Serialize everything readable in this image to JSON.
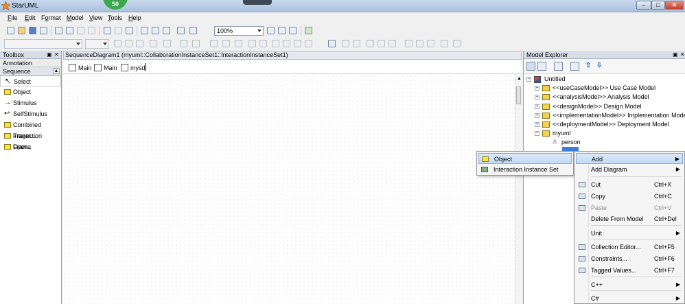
{
  "window": {
    "title": "StarUML",
    "badge": "50"
  },
  "menubar": [
    {
      "pre": "",
      "u": "F",
      "post": "ile"
    },
    {
      "pre": "",
      "u": "E",
      "post": "dit"
    },
    {
      "pre": "F",
      "u": "o",
      "post": "rmat"
    },
    {
      "pre": "",
      "u": "M",
      "post": "odel"
    },
    {
      "pre": "",
      "u": "V",
      "post": "iew"
    },
    {
      "pre": "",
      "u": "T",
      "post": "ools"
    },
    {
      "pre": "",
      "u": "H",
      "post": "elp"
    }
  ],
  "toolbar": {
    "zoom": "100%"
  },
  "toolbox": {
    "title": "Toolbox",
    "annotation_label": "Annotation",
    "sequence_label": "Sequence",
    "tools": [
      "Select",
      "Object",
      "Stimulus",
      "SelfStimulus",
      "Combined Fragm...",
      "Interaction Oper...",
      "Frame"
    ]
  },
  "diagram": {
    "header": "SequenceDiagram1 (myuml::CollaborationInstanceSet1::InteractionInstanceSet1)",
    "tabs": [
      "Main",
      "Main",
      "mysd"
    ]
  },
  "explorer": {
    "title": "Model Explorer",
    "tree": [
      "Untitled",
      "<<useCaseModel>> Use Case Model",
      "<<analysisModel>> Analysis Model",
      "<<designModel>> Design Model",
      "<<implementationModel>> Implementation Model",
      "<<deploymentModel>> Deployment Model",
      "myuml",
      "person"
    ]
  },
  "context_menu": {
    "submenu": [
      "Object",
      "Interaction Instance Set"
    ],
    "items": [
      {
        "label": "Add",
        "shortcut": "",
        "submenu": true
      },
      {
        "label": "Add Diagram",
        "shortcut": "",
        "submenu": true
      },
      {
        "label": "Cut",
        "shortcut": "Ctrl+X",
        "submenu": false
      },
      {
        "label": "Copy",
        "shortcut": "Ctrl+C",
        "submenu": false
      },
      {
        "label": "Paste",
        "shortcut": "Ctrl+V",
        "submenu": false
      },
      {
        "label": "Delete From Model",
        "shortcut": "Ctrl+Del",
        "submenu": false
      },
      {
        "label": "Unit",
        "shortcut": "",
        "submenu": true
      },
      {
        "label": "Collection Editor...",
        "shortcut": "Ctrl+F5",
        "submenu": false
      },
      {
        "label": "Constraints...",
        "shortcut": "Ctrl+F6",
        "submenu": false
      },
      {
        "label": "Tagged Values...",
        "shortcut": "Ctrl+F7",
        "submenu": false
      },
      {
        "label": "C++",
        "shortcut": "",
        "submenu": true
      },
      {
        "label": "C#",
        "shortcut": "",
        "submenu": true
      }
    ]
  }
}
